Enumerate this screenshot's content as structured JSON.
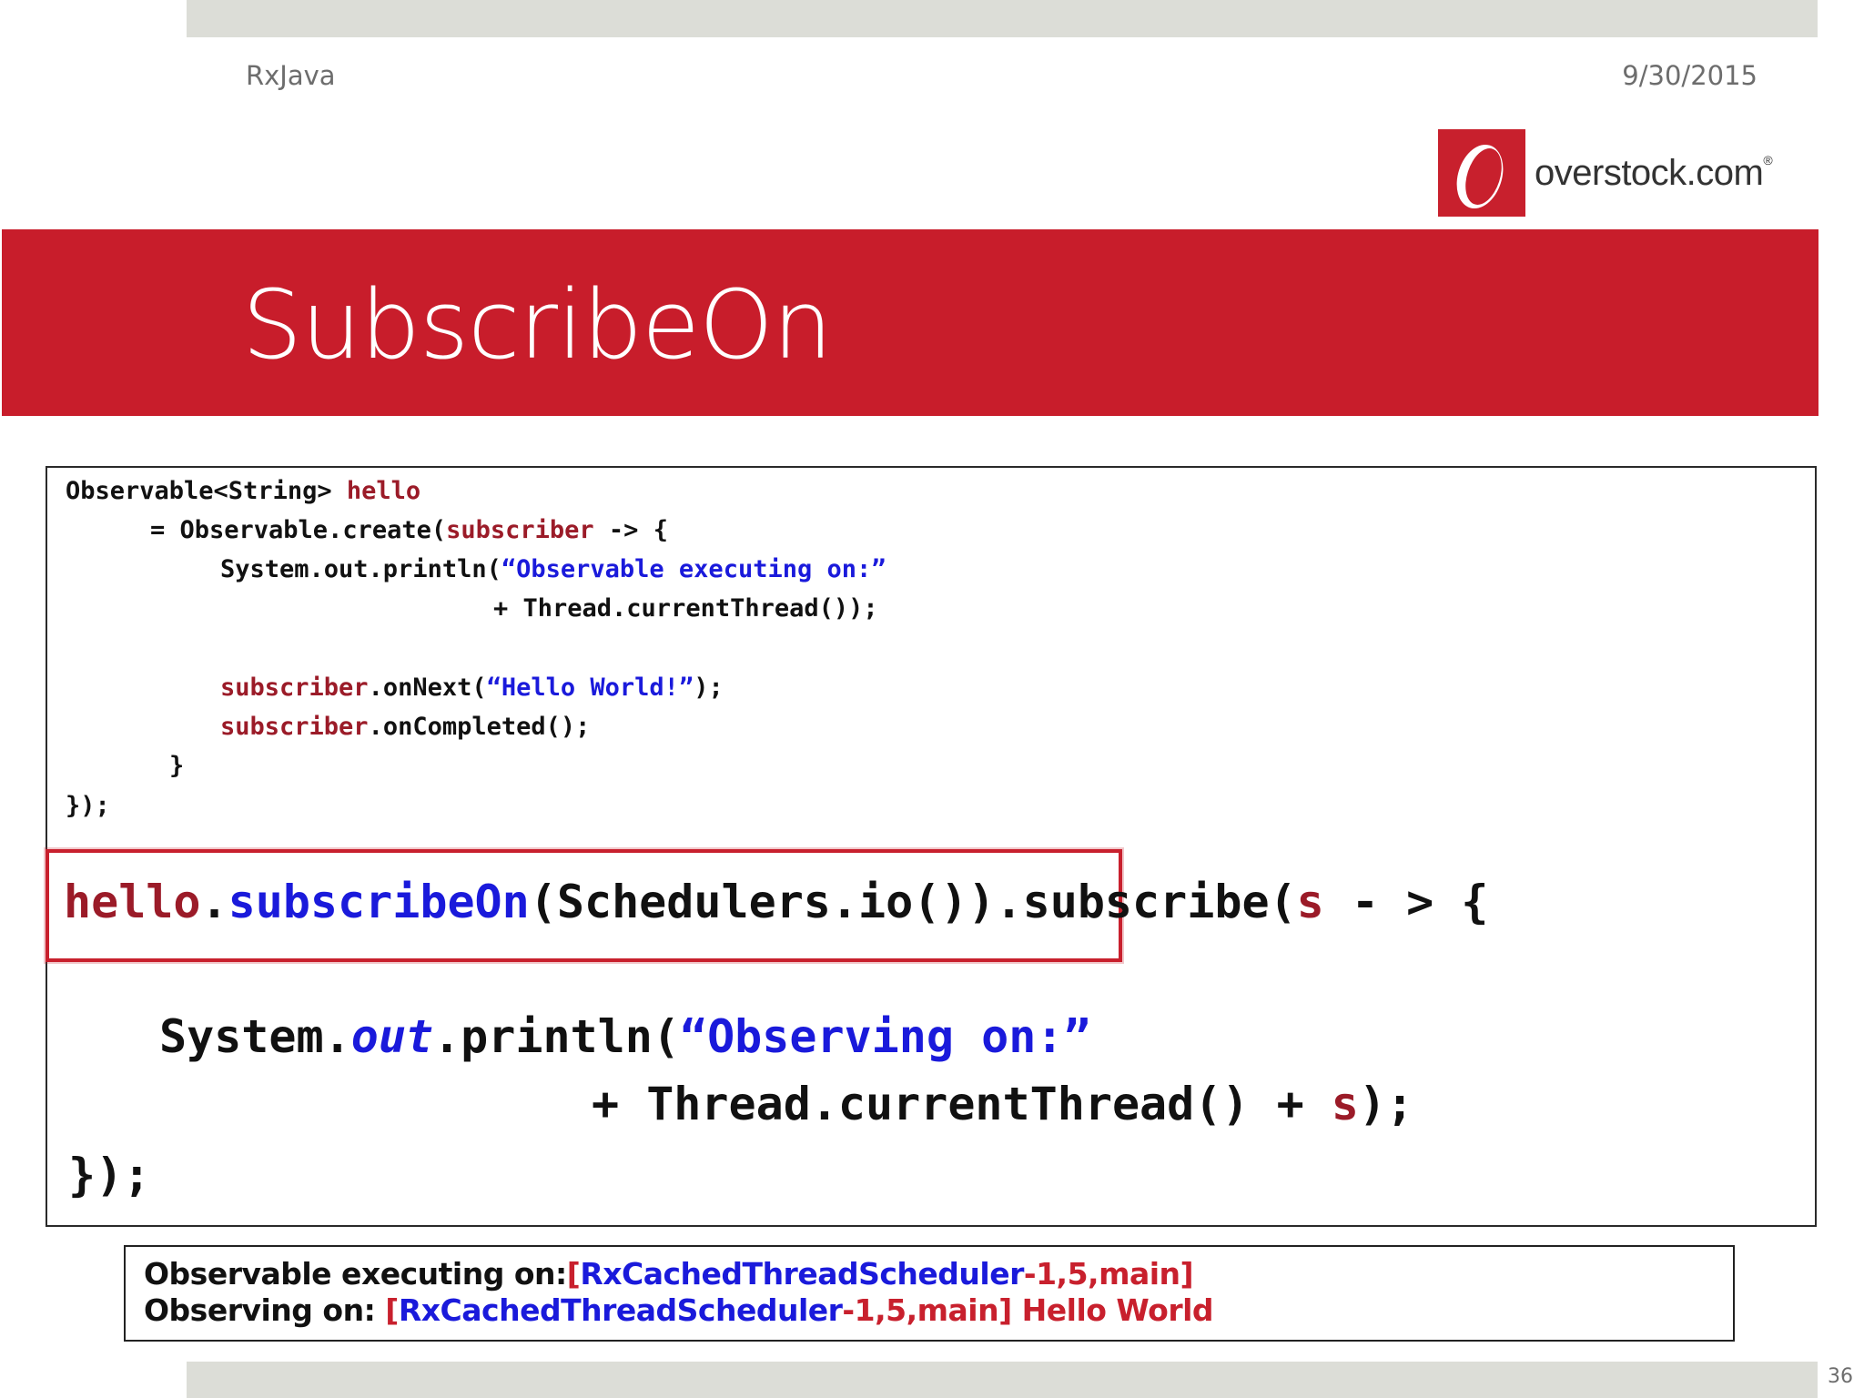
{
  "header": {
    "left": "RxJava",
    "right": "9/30/2015"
  },
  "logo": {
    "text": "overstock.com",
    "mark": "®"
  },
  "title": "SubscribeOn",
  "code_small": {
    "l1_a": "Observable<String> ",
    "l1_b": "hello",
    "l2_a": "= Observable.create(",
    "l2_b": "subscriber",
    "l2_c": " -> {",
    "l3_a": "System.out.println(",
    "l3_b": "“Observable executing on:”",
    "l4": "+ Thread.currentThread());",
    "l5_a": "subscriber",
    "l5_b": ".onNext(",
    "l5_c": "“Hello World!”",
    "l5_d": ");",
    "l6_a": "subscriber",
    "l6_b": ".onCompleted();",
    "l7": "}",
    "l8": "});"
  },
  "code_large": {
    "l1_a": "hello",
    "l1_b": ".",
    "l1_c": "subscribeOn",
    "l1_d": "(Schedulers.io())",
    "l1_e": ".subscribe(",
    "l1_f": "s",
    "l1_g": " - > {",
    "l2_a": "System.",
    "l2_b": "out",
    "l2_c": ".println(",
    "l2_d": "“Observing on:”",
    "l3_a": "+ Thread.currentThread() + ",
    "l3_b": "s",
    "l3_c": ");",
    "l4": "});"
  },
  "output": {
    "l1_a": "Observable executing on:",
    "l1_b": "[",
    "l1_c": "RxCachedThreadScheduler",
    "l1_d": "-1,5,main]",
    "l2_a": "Observing on: ",
    "l2_b": "[",
    "l2_c": "RxCachedThreadScheduler",
    "l2_d": "-1,5,main] Hello World"
  },
  "page_number": "36",
  "colors": {
    "brand_red": "#c81d2b",
    "keyword_blue": "#1a1adb",
    "variable_red": "#9b1b28",
    "band_gray": "#dcddd7"
  }
}
